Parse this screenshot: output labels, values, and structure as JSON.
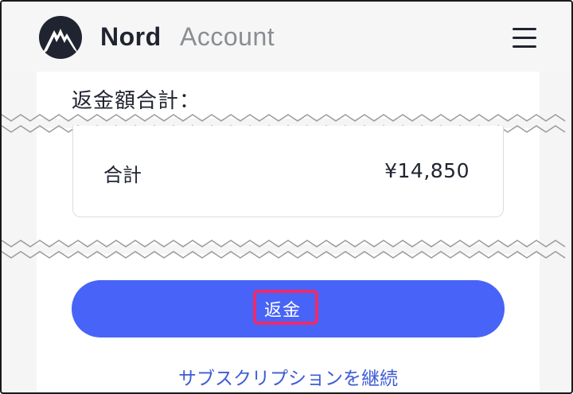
{
  "header": {
    "brand_name": "Nord",
    "brand_product": "Account",
    "logo_icon": "nord-mountain-icon",
    "menu_icon": "hamburger-menu-icon"
  },
  "refund": {
    "title": "返金額合計：",
    "total_label": "合計",
    "total_value": "¥14,850",
    "button_label": "返金",
    "continue_link": "サブスクリプションを継続"
  },
  "colors": {
    "button": "#4863f7",
    "highlight": "#ec2b6b",
    "link": "#3e5bd6",
    "brand_dark": "#202430"
  }
}
